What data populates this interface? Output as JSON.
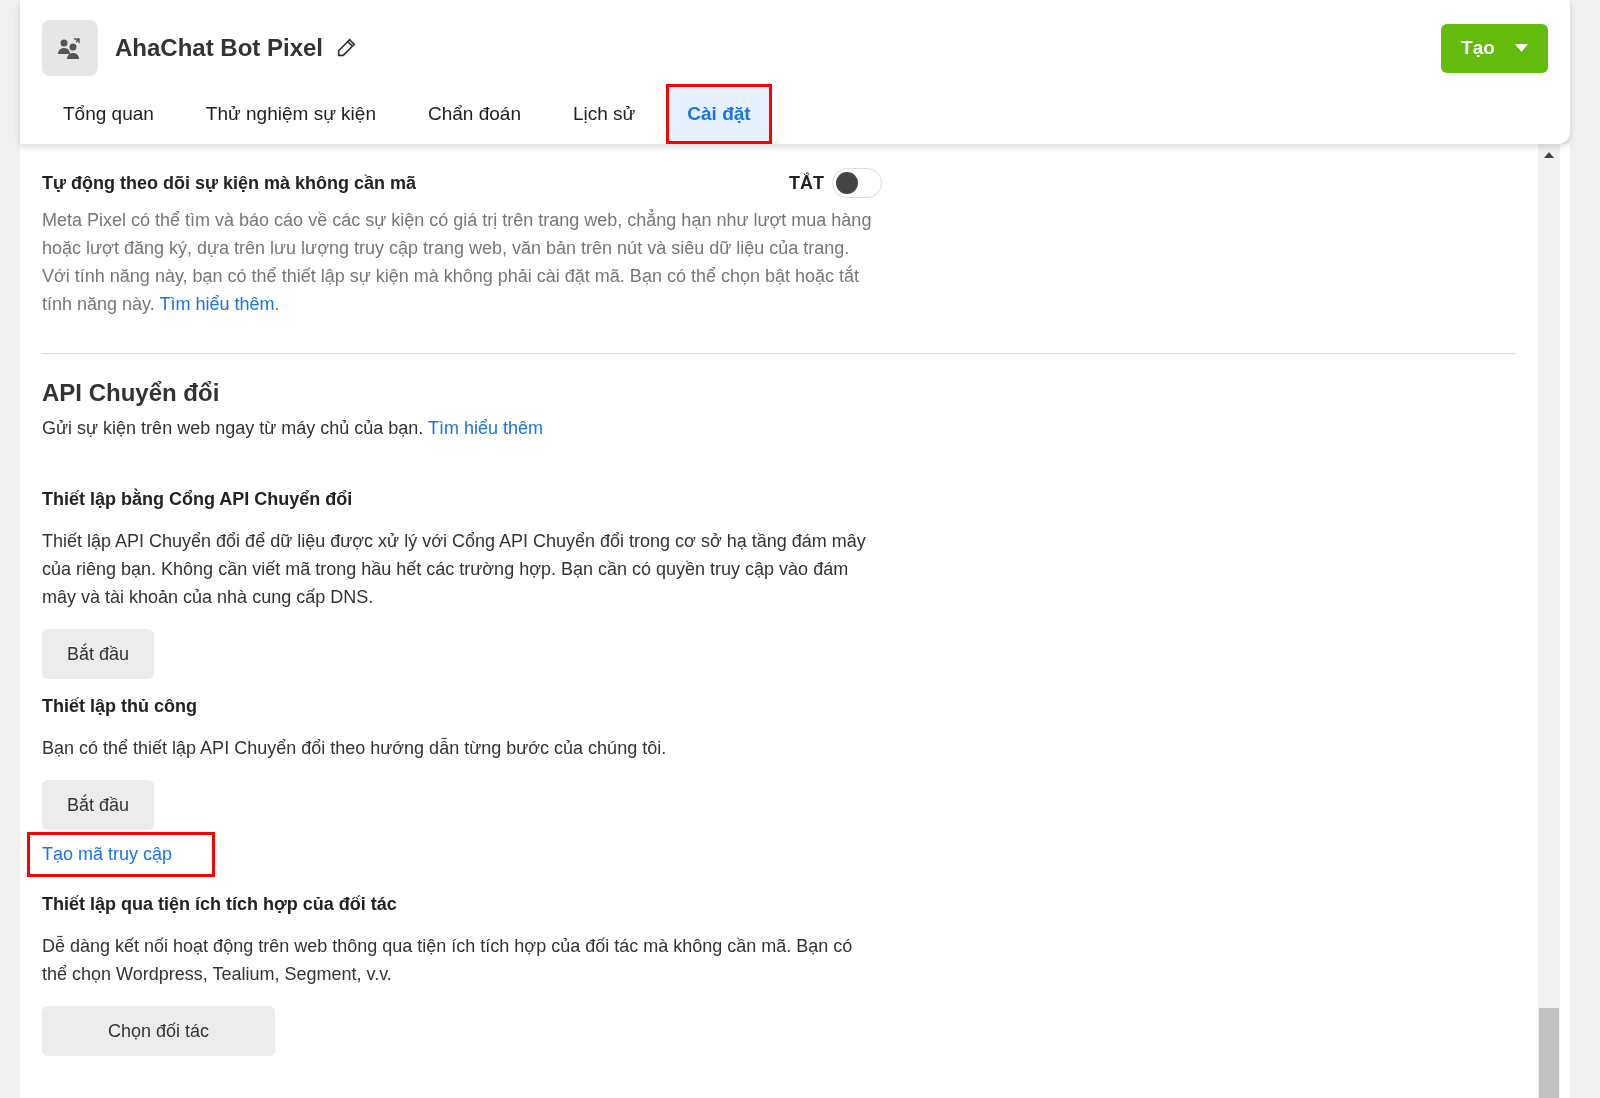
{
  "header": {
    "title": "AhaChat Bot Pixel",
    "create_button": "Tạo"
  },
  "tabs": [
    {
      "label": "Tổng quan",
      "selected": false,
      "highlighted": false
    },
    {
      "label": "Thử nghiệm sự kiện",
      "selected": false,
      "highlighted": false
    },
    {
      "label": "Chẩn đoán",
      "selected": false,
      "highlighted": false
    },
    {
      "label": "Lịch sử",
      "selected": false,
      "highlighted": false
    },
    {
      "label": "Cài đặt",
      "selected": true,
      "highlighted": true
    }
  ],
  "auto_tracking": {
    "title": "Tự động theo dõi sự kiện mà không cần mã",
    "toggle_label": "TẮT",
    "on": false,
    "description": "Meta Pixel có thể tìm và báo cáo về các sự kiện có giá trị trên trang web, chẳng hạn như lượt mua hàng hoặc lượt đăng ký, dựa trên lưu lượng truy cập trang web, văn bản trên nút và siêu dữ liệu của trang. Với tính năng này, bạn có thể thiết lập sự kiện mà không phải cài đặt mã. Bạn có thể chọn bật hoặc tắt tính năng này.",
    "link": "Tìm hiểu thêm",
    "link_suffix": "."
  },
  "conversions_api": {
    "title": "API Chuyển đổi",
    "subtitle": "Gửi sự kiện trên web ngay từ máy chủ của bạn.",
    "link": "Tìm hiểu thêm",
    "sections": [
      {
        "heading": "Thiết lập bằng Cổng API Chuyển đổi",
        "body": "Thiết lập API Chuyển đổi để dữ liệu được xử lý với Cổng API Chuyển đổi trong cơ sở hạ tầng đám mây của riêng bạn. Không cần viết mã trong hầu hết các trường hợp. Bạn cần có quyền truy cập vào đám mây và tài khoản của nhà cung cấp DNS.",
        "button": "Bắt đầu"
      },
      {
        "heading": "Thiết lập thủ công",
        "body": "Bạn có thể thiết lập API Chuyển đổi theo hướng dẫn từng bước của chúng tôi.",
        "button": "Bắt đầu",
        "extra_link": {
          "label": "Tạo mã truy cập",
          "highlighted": true
        }
      },
      {
        "heading": "Thiết lập qua tiện ích tích hợp của đối tác",
        "body": "Dễ dàng kết nối hoạt động trên web thông qua tiện ích tích hợp của đối tác mà không cần mã. Bạn có thể chọn Wordpress, Tealium, Segment, v.v.",
        "button": "Chọn đối tác"
      }
    ]
  }
}
